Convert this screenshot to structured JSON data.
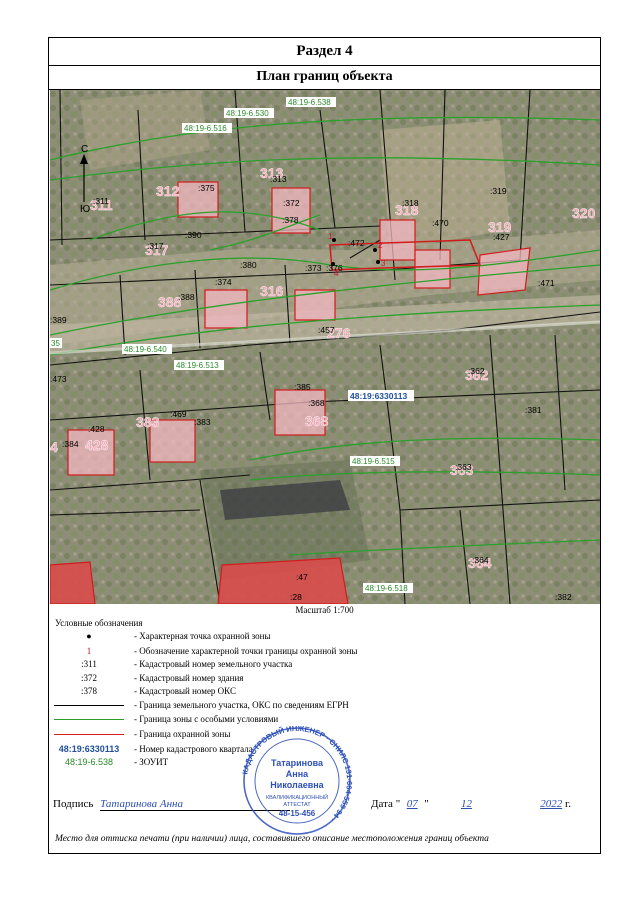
{
  "section_title": "Раздел 4",
  "plan_title": "План границ объекта",
  "scale": "Масштаб 1:700",
  "map": {
    "north_label": "С",
    "south_label": "Ю",
    "quarter": "48:19:6330113",
    "zouit": [
      "48:19-6.530",
      "48:19-6.538",
      "48:19-6.516",
      "48:19-6.540",
      "48:19-6.513",
      "48:19-6.515",
      "48:19-6.518",
      "35"
    ],
    "parcels": [
      ":311",
      ":317",
      ":390",
      ":389",
      ":388",
      ":378",
      ":472",
      ":471",
      ":470",
      ":427",
      ":473",
      ":469",
      ":428",
      ":384",
      ":385",
      ":368",
      ":380",
      ":363",
      ":362",
      ":381",
      ":364",
      ":47",
      ":28",
      ":457",
      ":382"
    ],
    "buildings": [
      ":375",
      ":372",
      ":374",
      ":373",
      ":313",
      ":383",
      ":376",
      ":318",
      ":319"
    ],
    "pink_numbers": [
      "311",
      "312",
      "313",
      "317",
      "388",
      "316",
      "276",
      "318",
      "319",
      "320",
      "383",
      "428",
      "368",
      "362",
      "363",
      "364",
      "4"
    ],
    "points": [
      "1",
      "2",
      "3",
      "4"
    ]
  },
  "legend": {
    "title": "Условные обозначения",
    "items": [
      {
        "symbol": "●",
        "text": "- Характерная точка охранной зоны",
        "color": "#000000"
      },
      {
        "symbol": "1",
        "text": "- Обозначение характерной точки границы охранной зоны",
        "color": "#c8102e"
      },
      {
        "symbol": ":311",
        "text": "- Кадастровый номер земельного участка",
        "color": "#000000"
      },
      {
        "symbol": ":372",
        "text": "- Кадастровый номер здания",
        "color": "#000000"
      },
      {
        "symbol": ":378",
        "text": "- Кадастровый номер ОКС",
        "color": "#000000"
      },
      {
        "symbol": "line-black",
        "text": "- Граница земельного участка, ОКС по сведениям ЕГРН",
        "color": "#000000"
      },
      {
        "symbol": "line-green",
        "text": "- Граница зоны с особыми условиями",
        "color": "#2a9d2a"
      },
      {
        "symbol": "line-red",
        "text": "- Граница охранной зоны",
        "color": "#d42020"
      },
      {
        "symbol": "48:19:6330113",
        "text": "- Номер кадастрового квартала",
        "color": "#1f4fa0"
      },
      {
        "symbol": "48:19-6.538",
        "text": "- ЗОУИТ",
        "color": "#2a8a2a"
      }
    ]
  },
  "signature": {
    "label": "Подпись",
    "text": "Татаринова Анна"
  },
  "date": {
    "label": "Дата",
    "day": "07",
    "month": "12",
    "year": "2022",
    "suffix": "г."
  },
  "footer_note": "Место для оттиска печати (при наличии) лица, составившего описание местоположения границ объекта",
  "stamp": {
    "outer": "КАДАСТРОВЫЙ ИНЖЕНЕР · СНИЛС 131-664-559 94 ·",
    "name1": "Татаринова",
    "name2": "Анна",
    "name3": "Николаевна",
    "att1": "КВАЛИФИКАЦИОННЫЙ",
    "att2": "АТТЕСТАТ",
    "number": "48-15-456"
  }
}
